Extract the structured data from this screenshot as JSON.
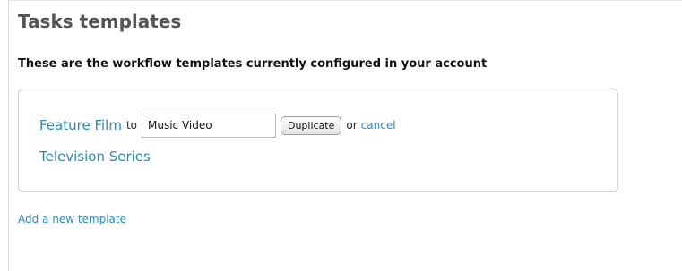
{
  "page": {
    "title": "Tasks templates",
    "subtitle": "These are the workflow templates currently configured in your account"
  },
  "templates": [
    {
      "name": "Feature Film",
      "duplicate_form": {
        "connector": "to",
        "new_name_value": "Music Video",
        "duplicate_label": "Duplicate",
        "or_text": "or",
        "cancel_label": "cancel"
      }
    },
    {
      "name": "Television Series"
    }
  ],
  "actions": {
    "add_template_label": "Add a new template"
  },
  "colors": {
    "link": "#2a8bb7",
    "title": "#555555",
    "box_border": "#cfcfcf"
  }
}
